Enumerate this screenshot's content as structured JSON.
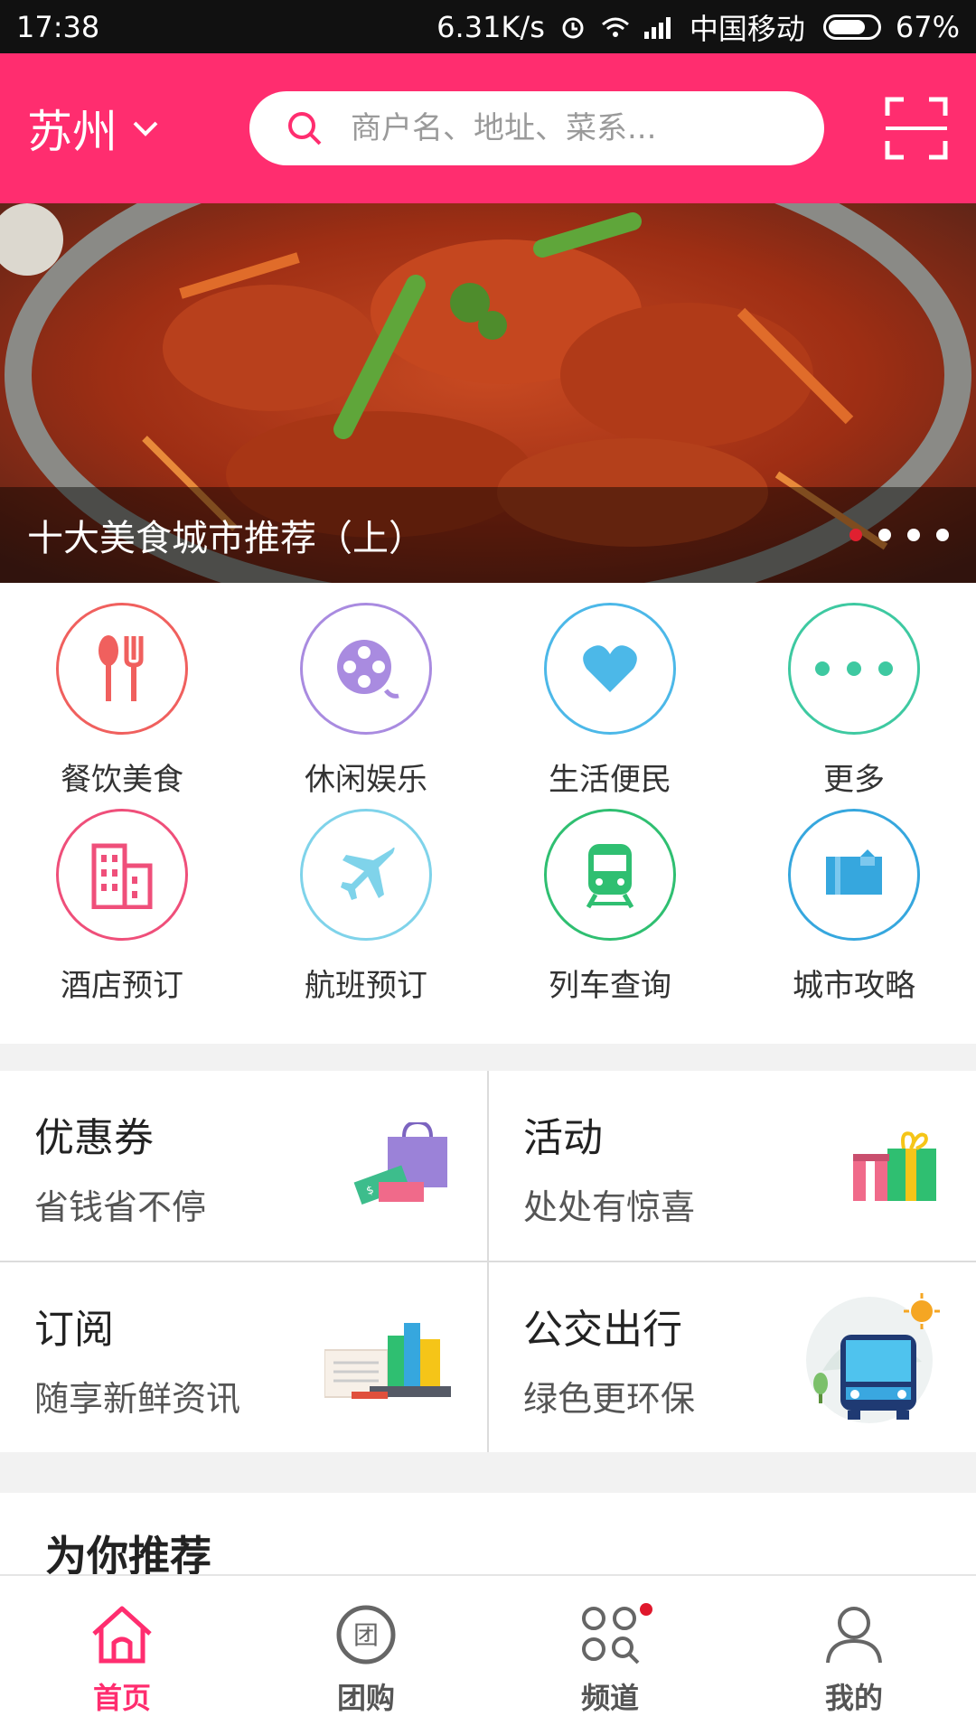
{
  "status_bar": {
    "time": "17:38",
    "speed": "6.31K/s",
    "carrier": "中国移动",
    "battery": "67%"
  },
  "header": {
    "city": "苏州",
    "search_placeholder": "商户名、地址、菜系..."
  },
  "banner": {
    "caption": "十大美食城市推荐（上）",
    "slide_count": 4,
    "active_slide": 0
  },
  "categories": [
    {
      "label": "餐饮美食",
      "icon": "fork-spoon-icon",
      "color": "#f0605e"
    },
    {
      "label": "休闲娱乐",
      "icon": "film-reel-icon",
      "color": "#a98be0"
    },
    {
      "label": "生活便民",
      "icon": "heart-icon",
      "color": "#4cb8e8"
    },
    {
      "label": "更多",
      "icon": "more-dots-icon",
      "color": "#3ec9a1"
    },
    {
      "label": "酒店预订",
      "icon": "hotel-building-icon",
      "color": "#ef4f7a"
    },
    {
      "label": "航班预订",
      "icon": "airplane-icon",
      "color": "#7fd3ea"
    },
    {
      "label": "列车查询",
      "icon": "train-icon",
      "color": "#2fbf71"
    },
    {
      "label": "城市攻略",
      "icon": "city-guide-icon",
      "color": "#36a7de"
    }
  ],
  "promos": [
    {
      "title": "优惠券",
      "subtitle": "省钱省不停",
      "icon": "coupon-bag-icon"
    },
    {
      "title": "活动",
      "subtitle": "处处有惊喜",
      "icon": "gift-boxes-icon"
    },
    {
      "title": "订阅",
      "subtitle": "随享新鲜资讯",
      "icon": "books-icon"
    },
    {
      "title": "公交出行",
      "subtitle": "绿色更环保",
      "icon": "bus-icon"
    }
  ],
  "recommend": {
    "title": "为你推荐"
  },
  "tabs": [
    {
      "label": "首页",
      "icon": "home-icon",
      "active": true
    },
    {
      "label": "团购",
      "icon": "group-buy-icon",
      "active": false
    },
    {
      "label": "频道",
      "icon": "channel-icon",
      "active": false,
      "badge": true
    },
    {
      "label": "我的",
      "icon": "profile-icon",
      "active": false
    }
  ],
  "colors": {
    "brand": "#ff2d6f",
    "badge": "#e0182c"
  }
}
